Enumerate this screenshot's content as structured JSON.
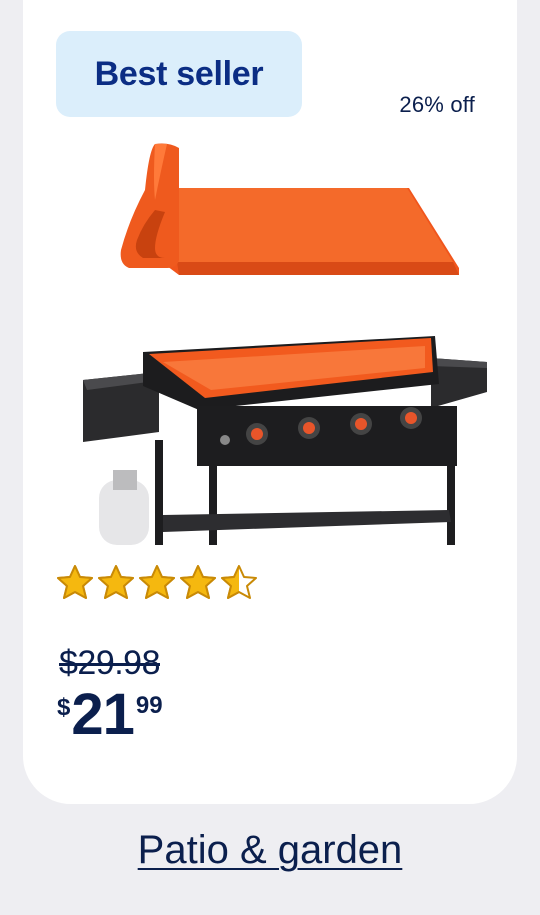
{
  "card": {
    "badge": "Best seller",
    "discount": "26% off",
    "image_icon": "griddle-with-silicone-mat-image",
    "rating": {
      "value": 4.5,
      "max": 5,
      "star_color": "#f5b80f"
    },
    "was_price": "$29.98",
    "now_price": {
      "currency": "$",
      "dollars": "21",
      "cents": "99"
    }
  },
  "category_link": "Patio & garden",
  "colors": {
    "accent": "#0b2d84",
    "text": "#0b1f4d",
    "badge_bg": "#dbeefb",
    "mat_orange": "#f25a1e",
    "page_bg": "#eeeef2"
  }
}
